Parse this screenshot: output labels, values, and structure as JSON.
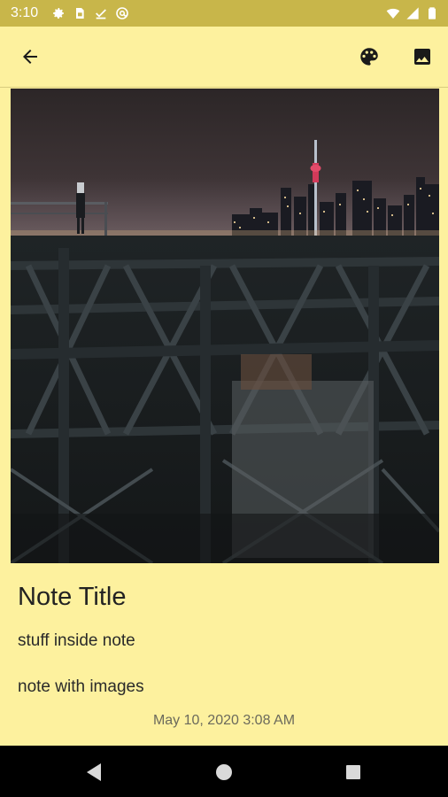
{
  "status_bar": {
    "time": "3:10",
    "left_icons": [
      "settings-icon",
      "sim-icon",
      "download-done-icon",
      "at-sign-icon"
    ],
    "right_icons": [
      "wifi-icon",
      "signal-icon",
      "battery-icon"
    ]
  },
  "app_bar": {
    "back_icon": "arrow-left-icon",
    "actions": [
      "palette-icon",
      "image-icon"
    ]
  },
  "note": {
    "title": "Note Title",
    "body_lines": [
      "stuff inside note",
      "note with images"
    ],
    "date": "May 10, 2020 3:08 AM"
  },
  "colors": {
    "status_bar": "#c8b64a",
    "background": "#fdf19e",
    "text": "#222222",
    "date_text": "#6b6a5c"
  },
  "nav_bar": {
    "buttons": [
      "back-triangle-icon",
      "home-circle-icon",
      "recents-square-icon"
    ]
  }
}
